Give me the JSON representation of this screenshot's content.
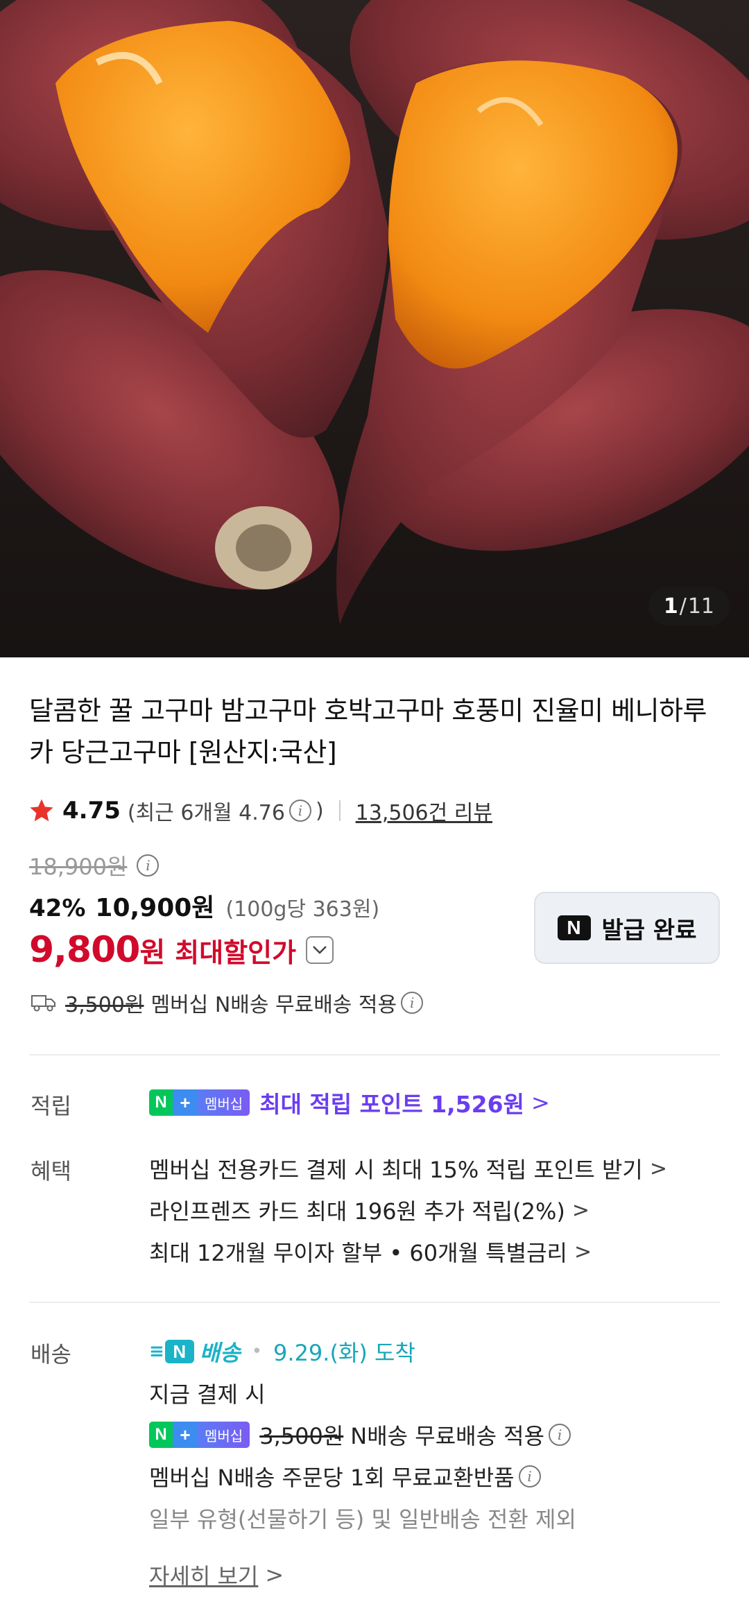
{
  "image": {
    "current": "1",
    "separator": "/",
    "total": "11"
  },
  "product": {
    "title": "달콤한 꿀 고구마 밤고구마 호박고구마 호풍미 진율미 베니하루카 당근고구마 [원산지:국산]"
  },
  "rating": {
    "value": "4.75",
    "recent_prefix": "(최근 6개월 4.76",
    "recent_suffix": ")",
    "reviews": "13,506건 리뷰"
  },
  "price": {
    "original": "18,900원",
    "discount": "42%",
    "sale": "10,900원",
    "unit": "(100g당 363원)",
    "max_amount": "9,800",
    "max_won": "원",
    "max_label": "최대할인가"
  },
  "coupon": {
    "badge": "N",
    "label": "발급 완료"
  },
  "shipping_summary": {
    "fee": "3,500원",
    "text": "멤버십 N배송 무료배송 적용"
  },
  "membership_badge": {
    "n": "N",
    "plus": "+",
    "text": "멤버십"
  },
  "points": {
    "label": "적립",
    "text": "최대 적립 포인트 1,526원",
    "chevron": ">"
  },
  "benefits": {
    "label": "혜택",
    "items": [
      "멤버십 전용카드 결제 시 최대 15% 적립 포인트 받기",
      "라인프렌즈 카드 최대 196원 추가 적립(2%)",
      "최대 12개월 무이자 할부 • 60개월 특별금리"
    ]
  },
  "delivery": {
    "label": "배송",
    "brand_n": "N",
    "brand_text": "배송",
    "dot": "•",
    "arrival": "9.29.(화) 도착",
    "pay_now": "지금 결제 시",
    "fee": "3,500원",
    "free_text": "N배송 무료배송 적용",
    "exchange": "멤버십 N배송 주문당 1회 무료교환반품",
    "exclusion": "일부 유형(선물하기 등) 및 일반배송 전환 제외",
    "detail_link": "자세히 보기"
  },
  "colors": {
    "sale_red": "#d10a2b",
    "membership_purple": "#6a3df0",
    "delivery_teal": "#1bb3c8",
    "naver_green": "#03c75a",
    "star": "#e8342a"
  },
  "icons": [
    "star-icon",
    "info-icon",
    "chevron-down-icon",
    "truck-icon",
    "chevron-right-icon"
  ]
}
